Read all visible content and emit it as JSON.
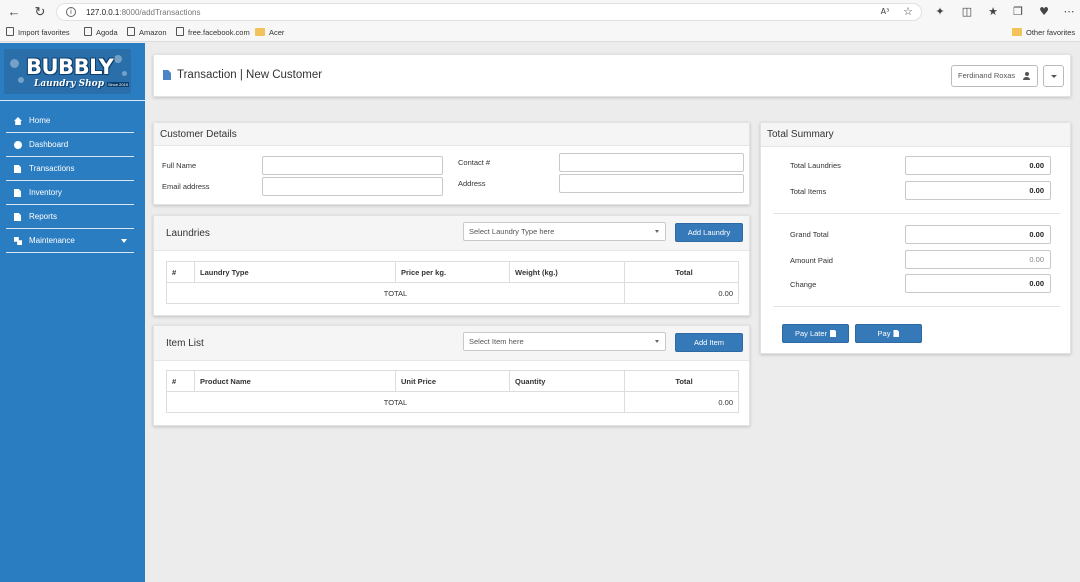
{
  "browser": {
    "url_host": "127.0.0.1",
    "url_path": ":8000/addTransactions",
    "bookmarks": [
      "Import favorites",
      "Agoda",
      "Amazon",
      "free.facebook.com",
      "Acer"
    ],
    "other_favorites": "Other favorites",
    "read_aloud_label": "A³"
  },
  "logo": {
    "name": "BUBBLY",
    "tagline": "Laundry Shop",
    "badge": "Since 2019"
  },
  "sidebar": {
    "items": [
      {
        "label": "Home",
        "icon": "home-icon"
      },
      {
        "label": "Dashboard",
        "icon": "dashboard-icon"
      },
      {
        "label": "Transactions",
        "icon": "file-icon"
      },
      {
        "label": "Inventory",
        "icon": "file-icon"
      },
      {
        "label": "Reports",
        "icon": "file-icon"
      },
      {
        "label": "Maintenance",
        "icon": "wrench-icon"
      }
    ]
  },
  "header": {
    "title": "Transaction | New Customer",
    "user": "Ferdinand Roxas"
  },
  "customer": {
    "title": "Customer Details",
    "full_name_label": "Full Name",
    "email_label": "Email address",
    "contact_label": "Contact #",
    "address_label": "Address"
  },
  "laundries": {
    "title": "Laundries",
    "select_placeholder": "Select Laundry Type here",
    "add_button": "Add Laundry",
    "columns": [
      "#",
      "Laundry Type",
      "Price per kg.",
      "Weight (kg.)",
      "Total"
    ],
    "total_label": "TOTAL",
    "total_value": "0.00"
  },
  "items": {
    "title": "Item List",
    "select_placeholder": "Select Item here",
    "add_button": "Add Item",
    "columns": [
      "#",
      "Product Name",
      "Unit Price",
      "Quantity",
      "Total"
    ],
    "total_label": "TOTAL",
    "total_value": "0.00"
  },
  "summary": {
    "title": "Total Summary",
    "total_laundries_label": "Total Laundries",
    "total_laundries": "0.00",
    "total_items_label": "Total Items",
    "total_items": "0.00",
    "grand_total_label": "Grand Total",
    "grand_total": "0.00",
    "amount_paid_label": "Amount Paid",
    "amount_paid": "0.00",
    "change_label": "Change",
    "change": "0.00",
    "pay_later_button": "Pay Later",
    "pay_button": "Pay"
  },
  "colors": {
    "sidebar": "#2b7dc2",
    "button": "#3579b8",
    "background": "#ececec"
  }
}
